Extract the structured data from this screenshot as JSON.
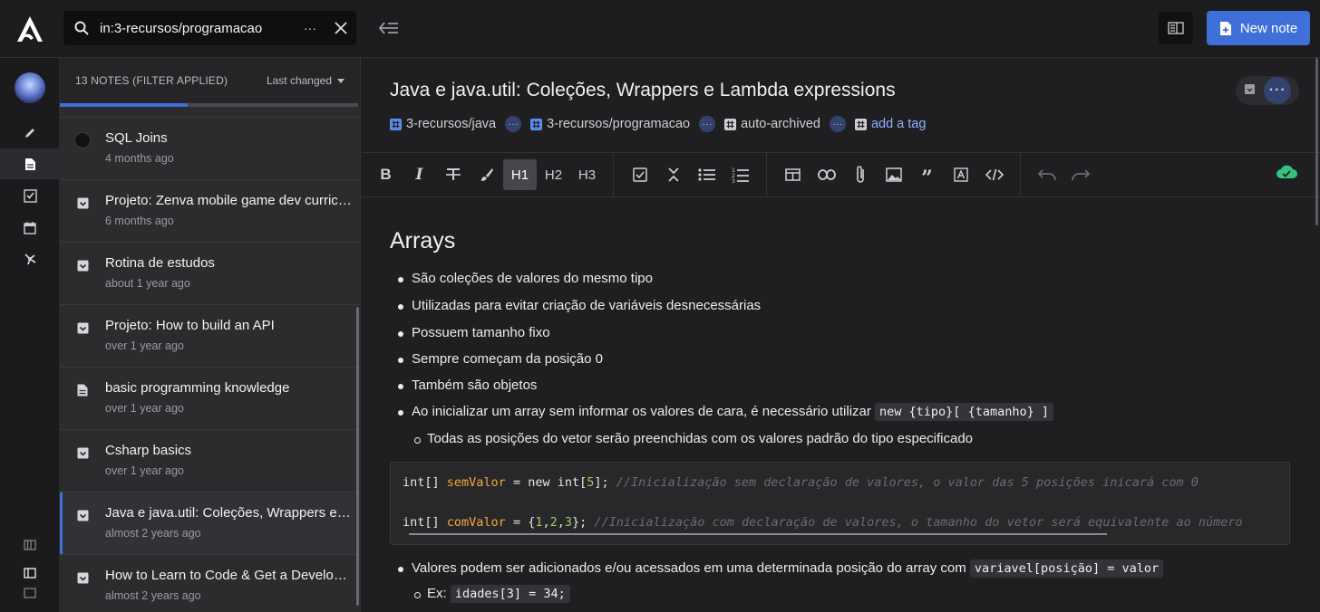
{
  "search": {
    "query": "in:3-recursos/programacao",
    "more_label": "···",
    "clear_label": "✕"
  },
  "header": {
    "new_note_label": "New note"
  },
  "notelist": {
    "count_label": "13 NOTES (FILTER APPLIED)",
    "sort_label": "Last changed",
    "progress": 0.43,
    "notes": [
      {
        "title": "SQL Joins",
        "date": "4 months ago",
        "icon": "task-circle",
        "selected": false
      },
      {
        "title": "Projeto: Zenva mobile game dev curriculum",
        "date": "6 months ago",
        "icon": "archive-icon",
        "selected": false
      },
      {
        "title": "Rotina de estudos",
        "date": "about 1 year ago",
        "icon": "archive-icon",
        "selected": false
      },
      {
        "title": "Projeto: How to build an API",
        "date": "over 1 year ago",
        "icon": "archive-icon",
        "selected": false
      },
      {
        "title": "basic programming knowledge",
        "date": "over 1 year ago",
        "icon": "document-icon",
        "selected": false
      },
      {
        "title": "Csharp basics",
        "date": "over 1 year ago",
        "icon": "archive-icon",
        "selected": false
      },
      {
        "title": "Java e java.util: Coleções, Wrappers e Lambda expressions",
        "date": "almost 2 years ago",
        "icon": "archive-icon",
        "selected": true
      },
      {
        "title": "How to Learn to Code & Get a Developer Job",
        "date": "almost 2 years ago",
        "icon": "archive-icon",
        "selected": false
      }
    ]
  },
  "editor": {
    "title": "Java e java.util: Coleções, Wrappers e Lambda expressions",
    "tags": [
      "3-recursos/java",
      "3-recursos/programacao",
      "auto-archived"
    ],
    "add_tag_label": "add a tag",
    "toolbar": {
      "h1": "H1",
      "h2": "H2",
      "h3": "H3"
    },
    "heading": "Arrays",
    "bullets": [
      "São coleções de valores do mesmo tipo",
      "Utilizadas para evitar criação de variáveis desnecessárias",
      "Possuem tamanho fixo",
      "Sempre começam da posição 0",
      "Também são objetos",
      "Ao inicializar um array sem informar os valores de cara, é necessário utilizar"
    ],
    "bullet6_code": "new {tipo}[ {tamanho} ]",
    "sub_bullet": "Todas as posições do vetor serão preenchidas com os valores padrão do tipo especificado",
    "code": {
      "line1_type": "int[] ",
      "line1_var": "semValor",
      "line1_mid": " = new int[",
      "line1_num": "5",
      "line1_end": "]; ",
      "line1_comment": "//Inicialização sem declaração de valores, o valor das 5 posições inicará com 0",
      "line2_type": "int[] ",
      "line2_var": "comValor",
      "line2_mid": " = {",
      "line2_n1": "1",
      "line2_c1": ",",
      "line2_n2": "2",
      "line2_c2": ",",
      "line2_n3": "3",
      "line2_end": "}; ",
      "line2_comment": "//Inicialização com declaração de valores, o tamanho do vetor será equivalente ao número"
    },
    "bullet7": "Valores podem ser adicionados e/ou acessados em uma determinada posição do array com",
    "bullet7_code": "variavel[posição] = valor",
    "sub_bullet2_label": "Ex:",
    "sub_bullet2_code": "idades[3] = 34;"
  },
  "colors": {
    "accent": "#3f6fd8",
    "sync": "#35c27c",
    "code_var": "#f0a93a",
    "code_num": "#9ccc65"
  }
}
